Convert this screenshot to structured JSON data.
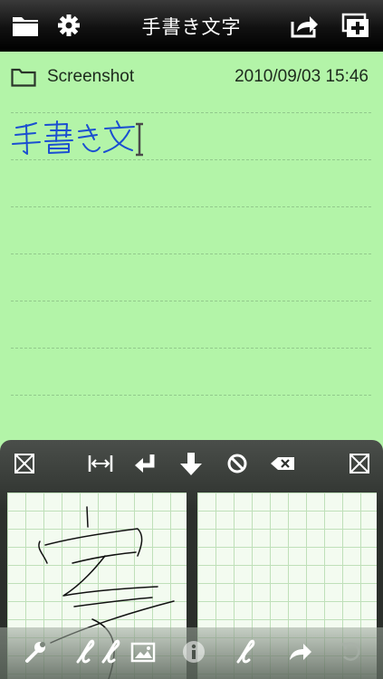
{
  "topbar": {
    "title": "手書き文字",
    "icons": [
      "folder-icon",
      "gear-icon",
      "share-icon",
      "new-note-icon"
    ]
  },
  "note": {
    "folder": "Screenshot",
    "date": "2010/09/03 15:46",
    "handwritten_text": "手書き文"
  },
  "panel": {
    "buttons": [
      "close-box-icon",
      "space-icon",
      "return-icon",
      "down-arrow-icon",
      "clear-icon",
      "backspace-icon",
      "close-box-icon"
    ],
    "tools": [
      "wrench-icon",
      "pen-icon",
      "pen-icon",
      "image-icon",
      "info-icon",
      "pen-icon",
      "redo-icon",
      "undo-icon"
    ]
  },
  "colors": {
    "paper": "#b3f4a8",
    "ink": "#1b4fd1",
    "toolbar": "#1a1a1a"
  }
}
